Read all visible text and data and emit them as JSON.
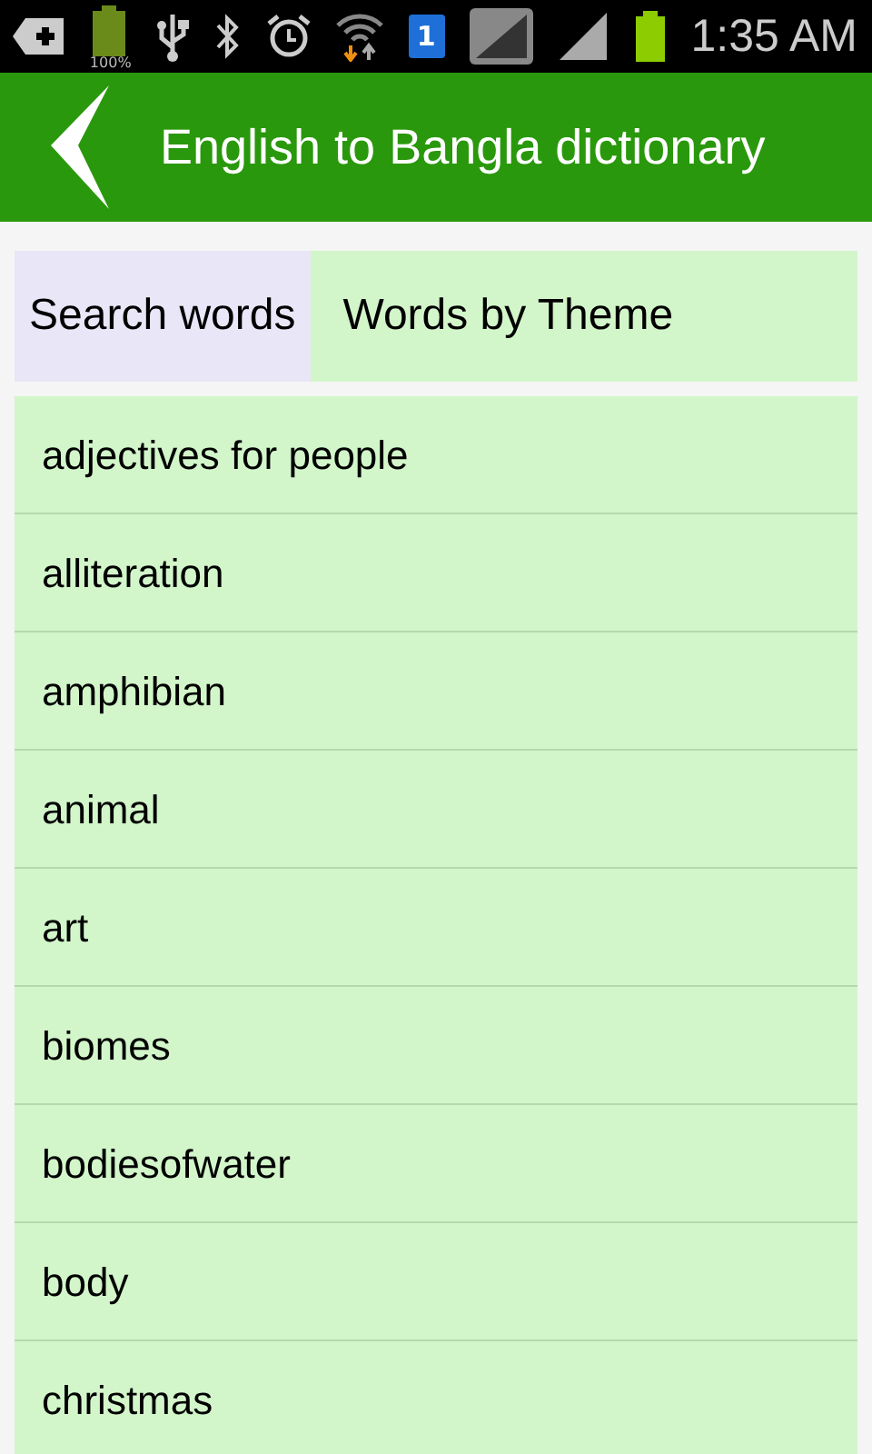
{
  "status_bar": {
    "battery_text": "100%",
    "sim_badge": "1",
    "time": "1:35 AM"
  },
  "header": {
    "title": "English to Bangla dictionary"
  },
  "tabs": [
    {
      "label": "Search words",
      "selected": false
    },
    {
      "label": "Words by Theme",
      "selected": true
    }
  ],
  "themes": [
    "adjectives for people",
    "alliteration",
    "amphibian",
    "animal",
    "art",
    "biomes",
    "bodiesofwater",
    "body",
    "christmas"
  ]
}
